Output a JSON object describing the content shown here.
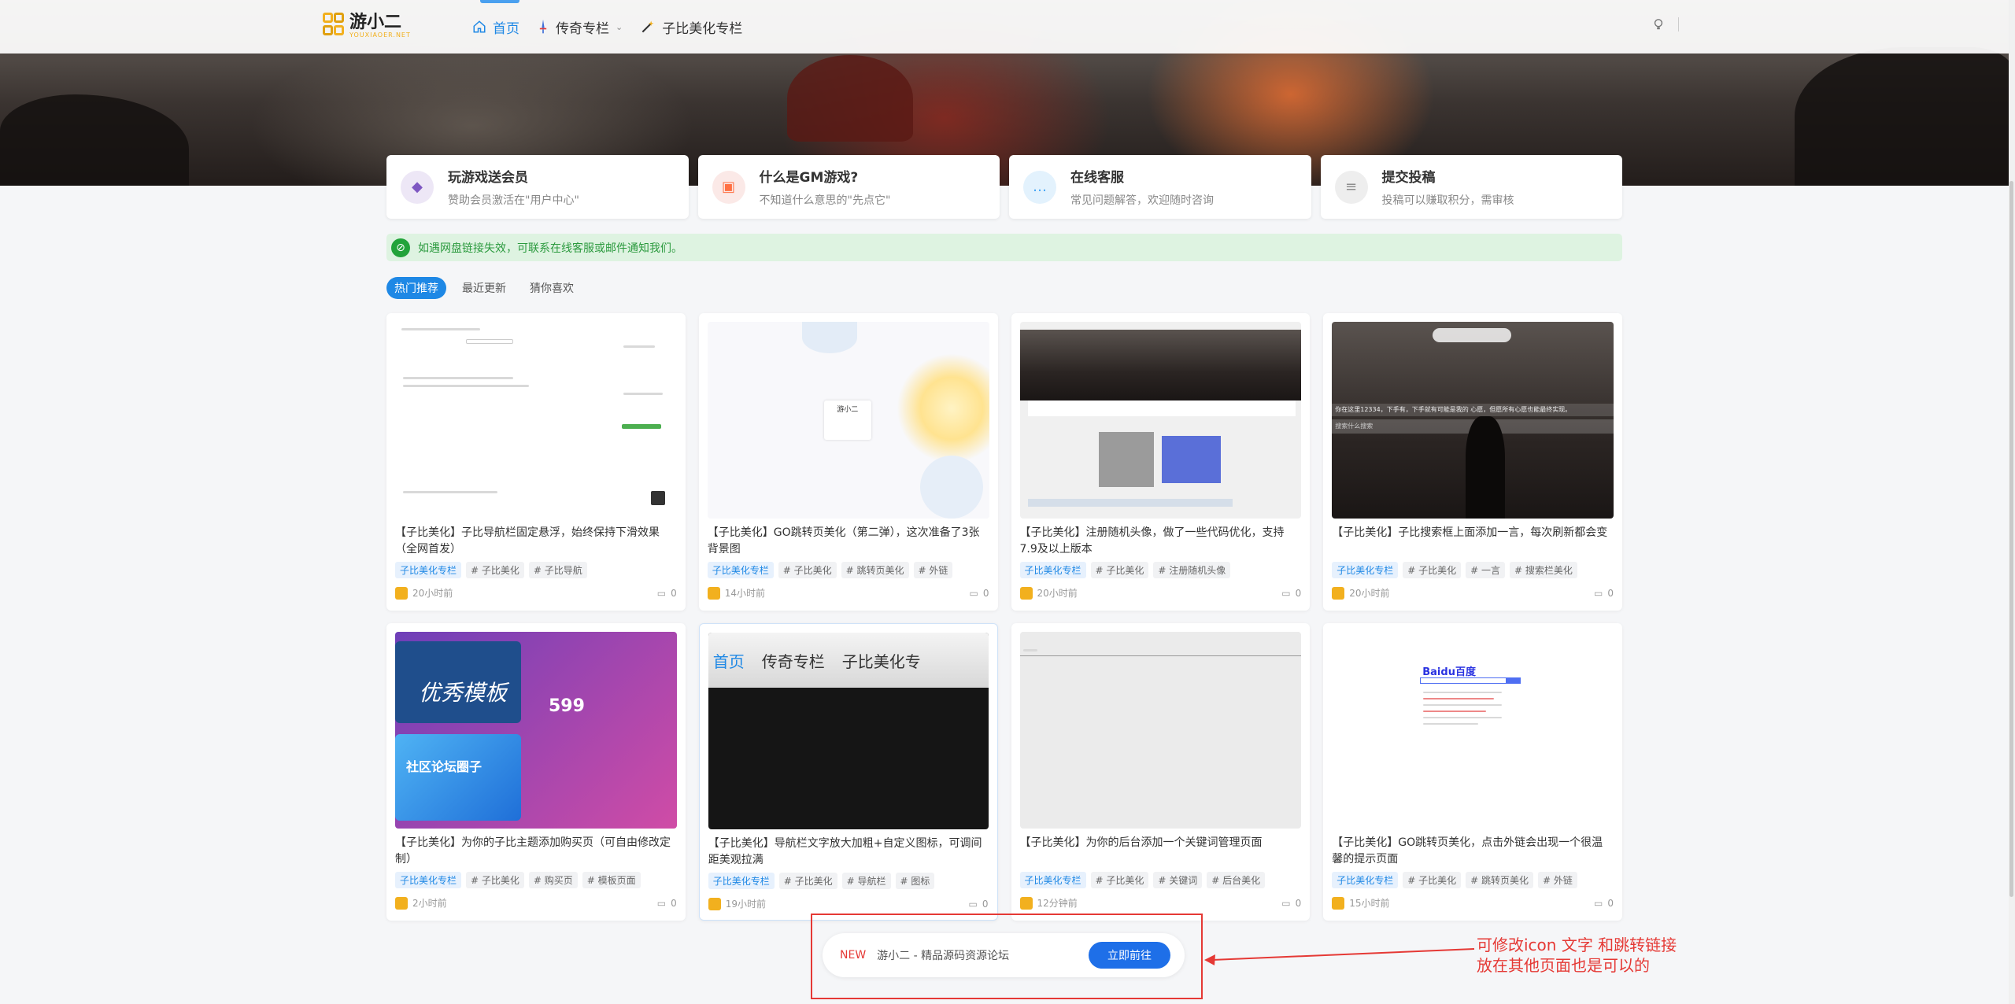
{
  "header": {
    "logo_text": "游小二",
    "logo_sub": "YOUXIAOER.NET",
    "nav": [
      {
        "label": "首页",
        "icon": "home-icon"
      },
      {
        "label": "传奇专栏",
        "icon": "sword-icon"
      },
      {
        "label": "子比美化专栏",
        "icon": "magic-wand-icon"
      }
    ]
  },
  "features": [
    {
      "title": "玩游戏送会员",
      "desc": "赞助会员激活在\"用户中心\"",
      "icon": "diamond-icon",
      "color": "#7e57c2",
      "bg": "#ede7f6"
    },
    {
      "title": "什么是GM游戏?",
      "desc": "不知道什么意思的\"先点它\"",
      "icon": "twitch-icon",
      "color": "#ff7043",
      "bg": "#fbe9e7"
    },
    {
      "title": "在线客服",
      "desc": "常见问题解答，欢迎随时咨询",
      "icon": "chat-icon",
      "color": "#42a5f5",
      "bg": "#e3f2fd"
    },
    {
      "title": "提交投稿",
      "desc": "投稿可以赚取积分，需审核",
      "icon": "document-icon",
      "color": "#8d8d8d",
      "bg": "#eeeeee"
    }
  ],
  "notice": {
    "text": "如遇网盘链接失效，可联系在线客服或邮件通知我们。"
  },
  "tabs": [
    "热门推荐",
    "最近更新",
    "猜你喜欢"
  ],
  "posts": [
    {
      "title": "【子比美化】子比导航栏固定悬浮，始终保持下滑效果（全网首发）",
      "tags": [
        "子比美化专栏",
        "# 子比美化",
        "# 子比导航"
      ],
      "time": "20小时前",
      "comments": "0"
    },
    {
      "title": "【子比美化】GO跳转页美化（第二弹），这次准备了3张背景图",
      "tags": [
        "子比美化专栏",
        "# 子比美化",
        "# 跳转页美化",
        "# 外链"
      ],
      "time": "14小时前",
      "comments": "0"
    },
    {
      "title": "【子比美化】注册随机头像，做了一些代码优化，支持7.9及以上版本",
      "tags": [
        "子比美化专栏",
        "# 子比美化",
        "# 注册随机头像"
      ],
      "time": "20小时前",
      "comments": "0"
    },
    {
      "title": "【子比美化】子比搜索框上面添加一言，每次刷新都会变",
      "tags": [
        "子比美化专栏",
        "# 子比美化",
        "# 一言",
        "# 搜索栏美化"
      ],
      "time": "20小时前",
      "comments": "0"
    },
    {
      "title": "【子比美化】为你的子比主题添加购买页（可自由修改定制）",
      "tags": [
        "子比美化专栏",
        "# 子比美化",
        "# 购买页",
        "# 模板页面"
      ],
      "time": "2小时前",
      "comments": "0"
    },
    {
      "title": "【子比美化】导航栏文字放大加粗+自定义图标，可调间距美观拉满",
      "tags": [
        "子比美化专栏",
        "# 子比美化",
        "# 导航栏",
        "# 图标"
      ],
      "time": "19小时前",
      "comments": "0"
    },
    {
      "title": "【子比美化】为你的后台添加一个关键词管理页面",
      "tags": [
        "子比美化专栏",
        "# 子比美化",
        "# 关键词",
        "# 后台美化"
      ],
      "time": "12分钟前",
      "comments": "0"
    },
    {
      "title": "【子比美化】GO跳转页美化，点击外链会出现一个很温馨的提示页面",
      "tags": [
        "子比美化专栏",
        "# 子比美化",
        "# 跳转页美化",
        "# 外链"
      ],
      "time": "15小时前",
      "comments": "0"
    }
  ],
  "thumb_texts": {
    "t2_logo": "游小二",
    "t4_search": "你在这里12334，下手有，下手就有可能是我的 心愿，但愿所有心愿也能最终实现。",
    "t4_placeholder": "搜索什么搜索",
    "t5_price": "599",
    "t5_cn1": "优秀模板",
    "t5_cn2": "社区论坛圈子",
    "t6_nav": [
      "首页",
      "传奇专栏",
      "子比美化专"
    ],
    "t8_logo": "Baidu百度"
  },
  "banner": {
    "new": "NEW",
    "text": "游小二 - 精品源码资源论坛",
    "button": "立即前往"
  },
  "annotation": {
    "line1": "可修改icon 文字 和跳转链接",
    "line2": "放在其他页面也是可以的"
  }
}
